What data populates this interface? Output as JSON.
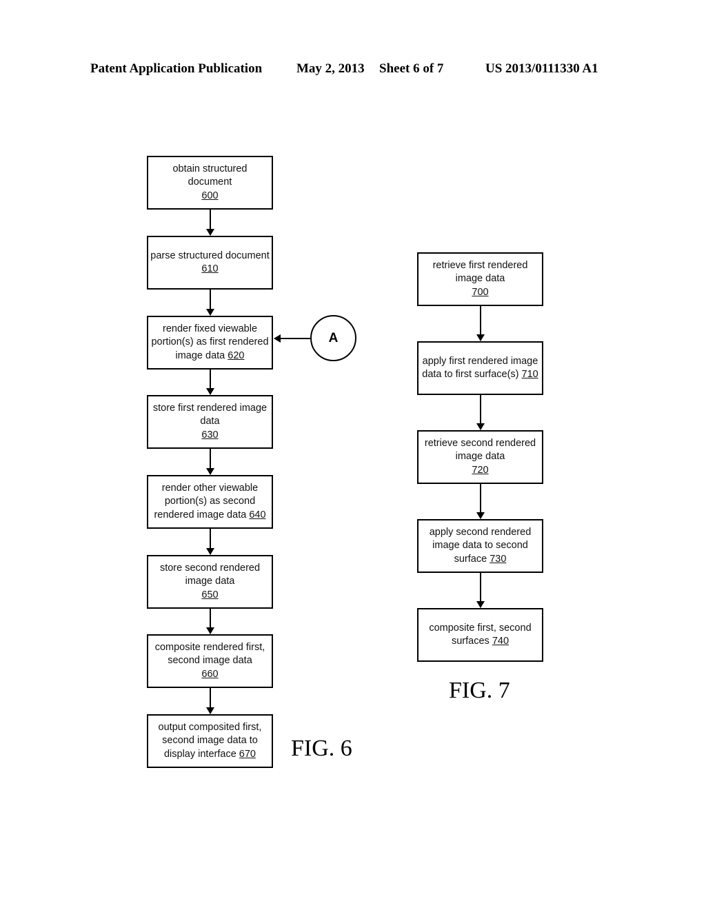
{
  "header": {
    "left": "Patent Application Publication",
    "date": "May 2, 2013",
    "sheet": "Sheet 6 of 7",
    "number": "US 2013/0111330 A1"
  },
  "fig6": {
    "label": "FIG. 6",
    "connector": "A",
    "steps": [
      {
        "text": "obtain structured document",
        "ref": "600"
      },
      {
        "text": "parse structured document",
        "ref": "610"
      },
      {
        "text": "render fixed viewable portion(s) as first rendered image data",
        "ref": "620"
      },
      {
        "text": "store first rendered image data",
        "ref": "630"
      },
      {
        "text": "render other viewable portion(s) as second rendered image data",
        "ref": "640"
      },
      {
        "text": "store second rendered image data",
        "ref": "650"
      },
      {
        "text": "composite rendered first, second image data",
        "ref": "660"
      },
      {
        "text": "output composited first, second image data to display interface",
        "ref": "670"
      }
    ]
  },
  "fig7": {
    "label": "FIG. 7",
    "steps": [
      {
        "text": "retrieve first rendered image data",
        "ref": "700"
      },
      {
        "text": "apply first rendered image data to first surface(s)",
        "ref": "710"
      },
      {
        "text": "retrieve second rendered image data",
        "ref": "720"
      },
      {
        "text": "apply second rendered image data to second surface",
        "ref": "730"
      },
      {
        "text": "composite first, second surfaces",
        "ref": "740"
      }
    ]
  }
}
